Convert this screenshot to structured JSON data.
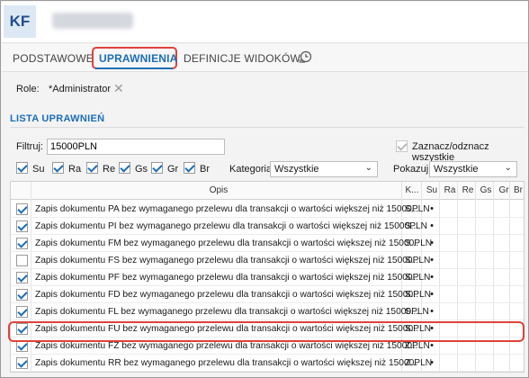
{
  "app": {
    "avatar_initials": "KF"
  },
  "tabs": [
    {
      "label": "PODSTAWOWE"
    },
    {
      "label": "UPRAWNIENIA"
    },
    {
      "label": "DEFINICJE WIDOKÓW"
    }
  ],
  "role": {
    "label": "Role:",
    "value": "*Administrator"
  },
  "section": {
    "title": "LISTA UPRAWNIEŃ"
  },
  "filter": {
    "label": "Filtruj:",
    "value": "15000PLN",
    "toggle_all_label": "Zaznacz/odznacz wszystkie"
  },
  "rights": [
    {
      "label": "Su"
    },
    {
      "label": "Ra"
    },
    {
      "label": "Re"
    },
    {
      "label": "Gs"
    },
    {
      "label": "Gr"
    },
    {
      "label": "Br"
    }
  ],
  "kategoria": {
    "label": "Kategoria:",
    "value": "Wszystkie"
  },
  "pokazuj": {
    "label": "Pokazuj:",
    "value": "Wszystkie"
  },
  "grid": {
    "columns": {
      "opis": "Opis",
      "k": "K...",
      "su": "Su",
      "ra": "Ra",
      "re": "Re",
      "gs": "Gs",
      "gr": "Gr",
      "br": "Br"
    },
    "rows": [
      {
        "checked": true,
        "desc": "Zapis dokumentu PA bez wymaganego przelewu dla transakcji o wartości większej niż 15000PLN",
        "kat": "S...",
        "su": "•"
      },
      {
        "checked": true,
        "desc": "Zapis dokumentu PI bez wymaganego przelewu dla transakcji o wartości większej niż 15000PLN",
        "kat": "S...",
        "su": "•"
      },
      {
        "checked": true,
        "desc": "Zapis dokumentu FM bez wymaganego przelewu dla transakcji o wartości większej niż 15000PLN",
        "kat": "S...",
        "su": "•"
      },
      {
        "checked": false,
        "desc": "Zapis dokumentu FS bez wymaganego przelewu dla transakcji o wartości większej niż 15000PLN",
        "kat": "S...",
        "su": "•"
      },
      {
        "checked": true,
        "desc": "Zapis dokumentu PF bez wymaganego przelewu dla transakcji o wartości większej niż 15000PLN",
        "kat": "S...",
        "su": "•"
      },
      {
        "checked": true,
        "desc": "Zapis dokumentu FD bez wymaganego przelewu dla transakcji o wartości większej niż 15000PLN",
        "kat": "S...",
        "su": "•"
      },
      {
        "checked": true,
        "desc": "Zapis dokumentu FL bez wymaganego przelewu dla transakcji o wartości większej niż 15000PLN",
        "kat": "S...",
        "su": "•"
      },
      {
        "checked": true,
        "desc": "Zapis dokumentu FU bez wymaganego przelewu dla transakcji o wartości większej niż 15000PLN",
        "kat": "S...",
        "su": "•"
      },
      {
        "checked": true,
        "desc": "Zapis dokumentu FZ bez wymaganego przelewu dla transakcji o wartości większej niż 15000PLN",
        "kat": "Z...",
        "su": "•"
      },
      {
        "checked": true,
        "desc": "Zapis dokumentu RR bez wymaganego przelewu dla transakcji o wartości większej niż 15000PLN",
        "kat": "Z...",
        "su": "•"
      }
    ]
  },
  "colors": {
    "accent": "#1b6db7",
    "highlight": "#e0413b"
  }
}
